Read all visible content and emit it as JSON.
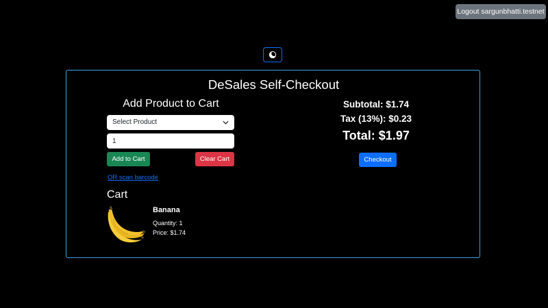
{
  "header": {
    "logout_label": "Logout sargunbhatti.testnet",
    "theme_toggle_icon": "moon-icon"
  },
  "app": {
    "title": "DeSales Self-Checkout"
  },
  "add_product": {
    "heading": "Add Product to Cart",
    "select_value": "Select Product",
    "quantity_value": "1",
    "add_button_label": "Add to Cart",
    "clear_button_label": "Clear Cart",
    "scan_link_label": "OR scan barcode"
  },
  "cart": {
    "heading": "Cart",
    "items": [
      {
        "name": "Banana",
        "quantity_text": "Quantity: 1",
        "price_text": "Price: $1.74",
        "image_icon": "banana-image"
      }
    ]
  },
  "summary": {
    "subtotal_text": "Subtotal: $1.74",
    "tax_text": "Tax (13%): $0.23",
    "total_text": "Total: $1.97",
    "checkout_label": "Checkout"
  },
  "colors": {
    "background": "#000000",
    "panel_border": "#3aa5e8",
    "primary": "#0d6efd",
    "success": "#198754",
    "danger": "#dc3545",
    "secondary": "#6c757d"
  }
}
